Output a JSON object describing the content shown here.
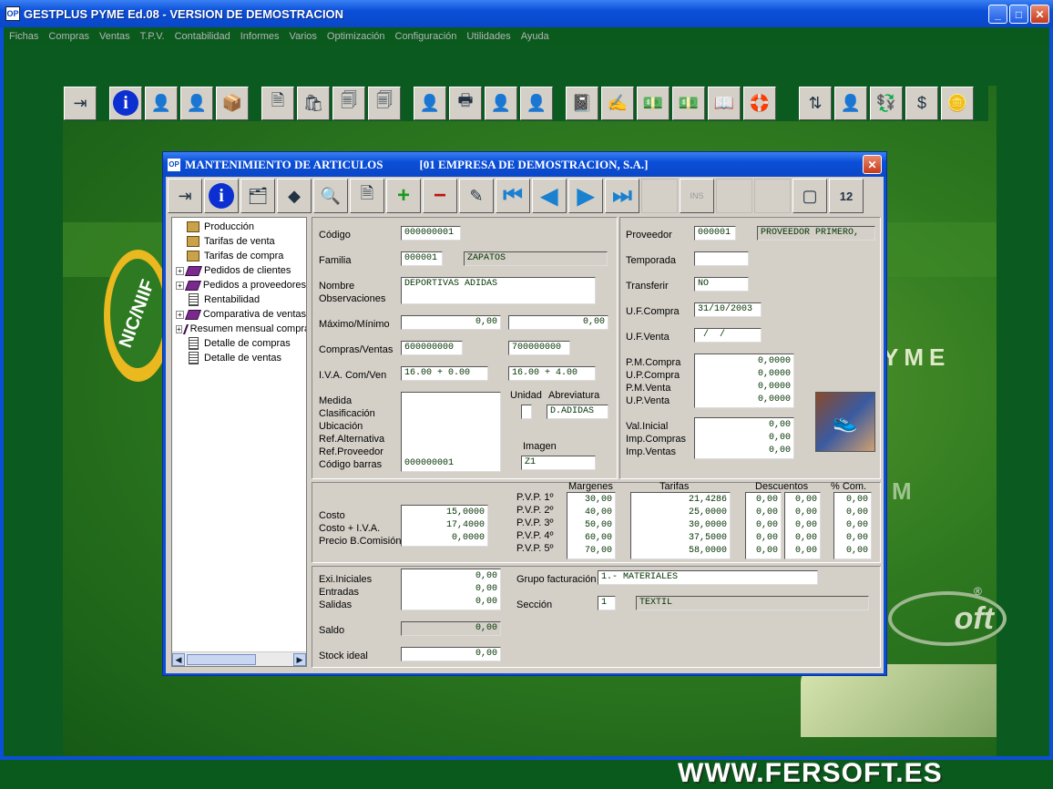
{
  "app": {
    "title": "GESTPLUS  PYME  Ed.08  -  VERSION DE DEMOSTRACION",
    "icon": "OP"
  },
  "menu": [
    "Fichas",
    "Compras",
    "Ventas",
    "T.P.V.",
    "Contabilidad",
    "Informes",
    "Varios",
    "Optimización",
    "Configuración",
    "Utilidades",
    "Ayuda"
  ],
  "hero": {
    "nic": "NIC/NIIF",
    "yme": "YME",
    "m": "M",
    "fersoft": "oft",
    "reg": "®",
    "url": "WWW.FERSOFT.ES"
  },
  "dialog": {
    "title": "MANTENIMIENTO DE ARTICULOS",
    "company": "[01  EMPRESA DE DEMOSTRACION, S.A.]",
    "ins": "INS"
  },
  "tree": [
    {
      "label": "Producción",
      "icon": "folder",
      "expand": false
    },
    {
      "label": "Tarifas de venta",
      "icon": "folder",
      "expand": false
    },
    {
      "label": "Tarifas de compra",
      "icon": "folder",
      "expand": false
    },
    {
      "label": "Pedidos de clientes",
      "icon": "book",
      "expand": true
    },
    {
      "label": "Pedidos a proveedores",
      "icon": "book",
      "expand": true
    },
    {
      "label": "Rentabilidad",
      "icon": "doc",
      "expand": false
    },
    {
      "label": "Comparativa de ventas",
      "icon": "book",
      "expand": true
    },
    {
      "label": "Resumen mensual compras",
      "icon": "book",
      "expand": true
    },
    {
      "label": "Detalle de compras",
      "icon": "doc",
      "expand": false
    },
    {
      "label": "Detalle de ventas",
      "icon": "doc",
      "expand": false
    }
  ],
  "form": {
    "codigo_lbl": "Código",
    "codigo": "000000001",
    "familia_lbl": "Familia",
    "familia_code": "000001",
    "familia_name": "ZAPATOS",
    "nombre_lbl": "Nombre",
    "observ_lbl": "Observaciones",
    "nombre": "DEPORTIVAS ADIDAS",
    "maxmin_lbl": "Máximo/Mínimo",
    "maximo": "0,00",
    "minimo": "0,00",
    "compven_lbl": "Compras/Ventas",
    "compras": "600000000",
    "ventas": "700000000",
    "iva_lbl": "I.V.A. Com/Ven",
    "iva_com": "16.00 +  0.00",
    "iva_ven": "16.00 +  4.00",
    "medida_lbl": "Medida",
    "clasif_lbl": "Clasificación",
    "ubic_lbl": "Ubicación",
    "refalt_lbl": "Ref.Alternativa",
    "refprov_lbl": "Ref.Proveedor",
    "codbar_lbl": "Código barras",
    "codbar": "000000001",
    "unidad_lbl": "Unidad",
    "abrev_lbl": "Abreviatura",
    "abrev": "D.ADIDAS",
    "imagen_lbl": "Imagen",
    "imagen": "Z1"
  },
  "prov": {
    "proveedor_lbl": "Proveedor",
    "proveedor_code": "000001",
    "proveedor_name": "PROVEEDOR PRIMERO,",
    "temporada_lbl": "Temporada",
    "temporada": "",
    "transfer_lbl": "Transferir",
    "transfer": "NO",
    "ufcompra_lbl": "U.F.Compra",
    "ufcompra": "31/10/2003",
    "ufventa_lbl": "U.F.Venta",
    "ufventa": " /  /",
    "pmc_lbl": "P.M.Compra",
    "upc_lbl": "U.P.Compra",
    "pmv_lbl": "P.M.Venta",
    "upv_lbl": "U.P.Venta",
    "precios": "0,0000\n0,0000\n0,0000\n0,0000",
    "vi_lbl": "Val.Inicial",
    "ic_lbl": "Imp.Compras",
    "iv_lbl": "Imp.Ventas",
    "valores": "0,00\n0,00\n0,00"
  },
  "precios": {
    "margenes_h": "Margenes",
    "tarifas_h": "Tarifas",
    "descuentos_h": "Descuentos",
    "com_h": "% Com.",
    "costo_lbl": "Costo",
    "costoiva_lbl": "Costo + I.V.A.",
    "preciob_lbl": "Precio B.Comisión",
    "costos": "15,0000\n17,4000\n0,0000",
    "pvp_labels": [
      "P.V.P. 1º",
      "P.V.P. 2º",
      "P.V.P. 3º",
      "P.V.P. 4º",
      "P.V.P. 5º"
    ],
    "margenes": "30,00\n40,00\n50,00\n60,00\n70,00",
    "tarifas": "21,4286\n25,0000\n30,0000\n37,5000\n58,0000",
    "desc1": "0,00\n0,00\n0,00\n0,00\n0,00",
    "desc2": "0,00\n0,00\n0,00\n0,00\n0,00",
    "com": "0,00\n0,00\n0,00\n0,00\n0,00"
  },
  "stock": {
    "exi_lbl": "Exi.Iniciales",
    "ent_lbl": "Entradas",
    "sal_lbl": "Salidas",
    "vals": "0,00\n0,00\n0,00",
    "saldo_lbl": "Saldo",
    "saldo": "0,00",
    "ideal_lbl": "Stock ideal",
    "ideal": "0,00",
    "grupo_lbl": "Grupo facturación",
    "grupo": "1.- MATERIALES",
    "seccion_lbl": "Sección",
    "seccion_code": "1",
    "seccion_name": "TEXTIL"
  }
}
